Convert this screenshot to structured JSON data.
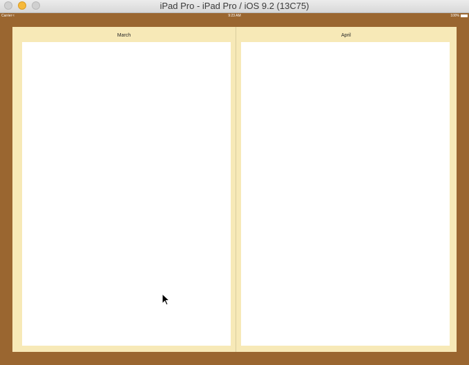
{
  "window": {
    "title": "iPad Pro - iPad Pro / iOS 9.2 (13C75)"
  },
  "status_bar": {
    "carrier": "Carrier",
    "time": "9:23 AM",
    "battery": "100%"
  },
  "calendar": {
    "left_page": {
      "month": "March"
    },
    "right_page": {
      "month": "April"
    }
  },
  "colors": {
    "background": "#9a6630",
    "page": "#f7e9b7",
    "calendar_area": "#ffffff"
  }
}
